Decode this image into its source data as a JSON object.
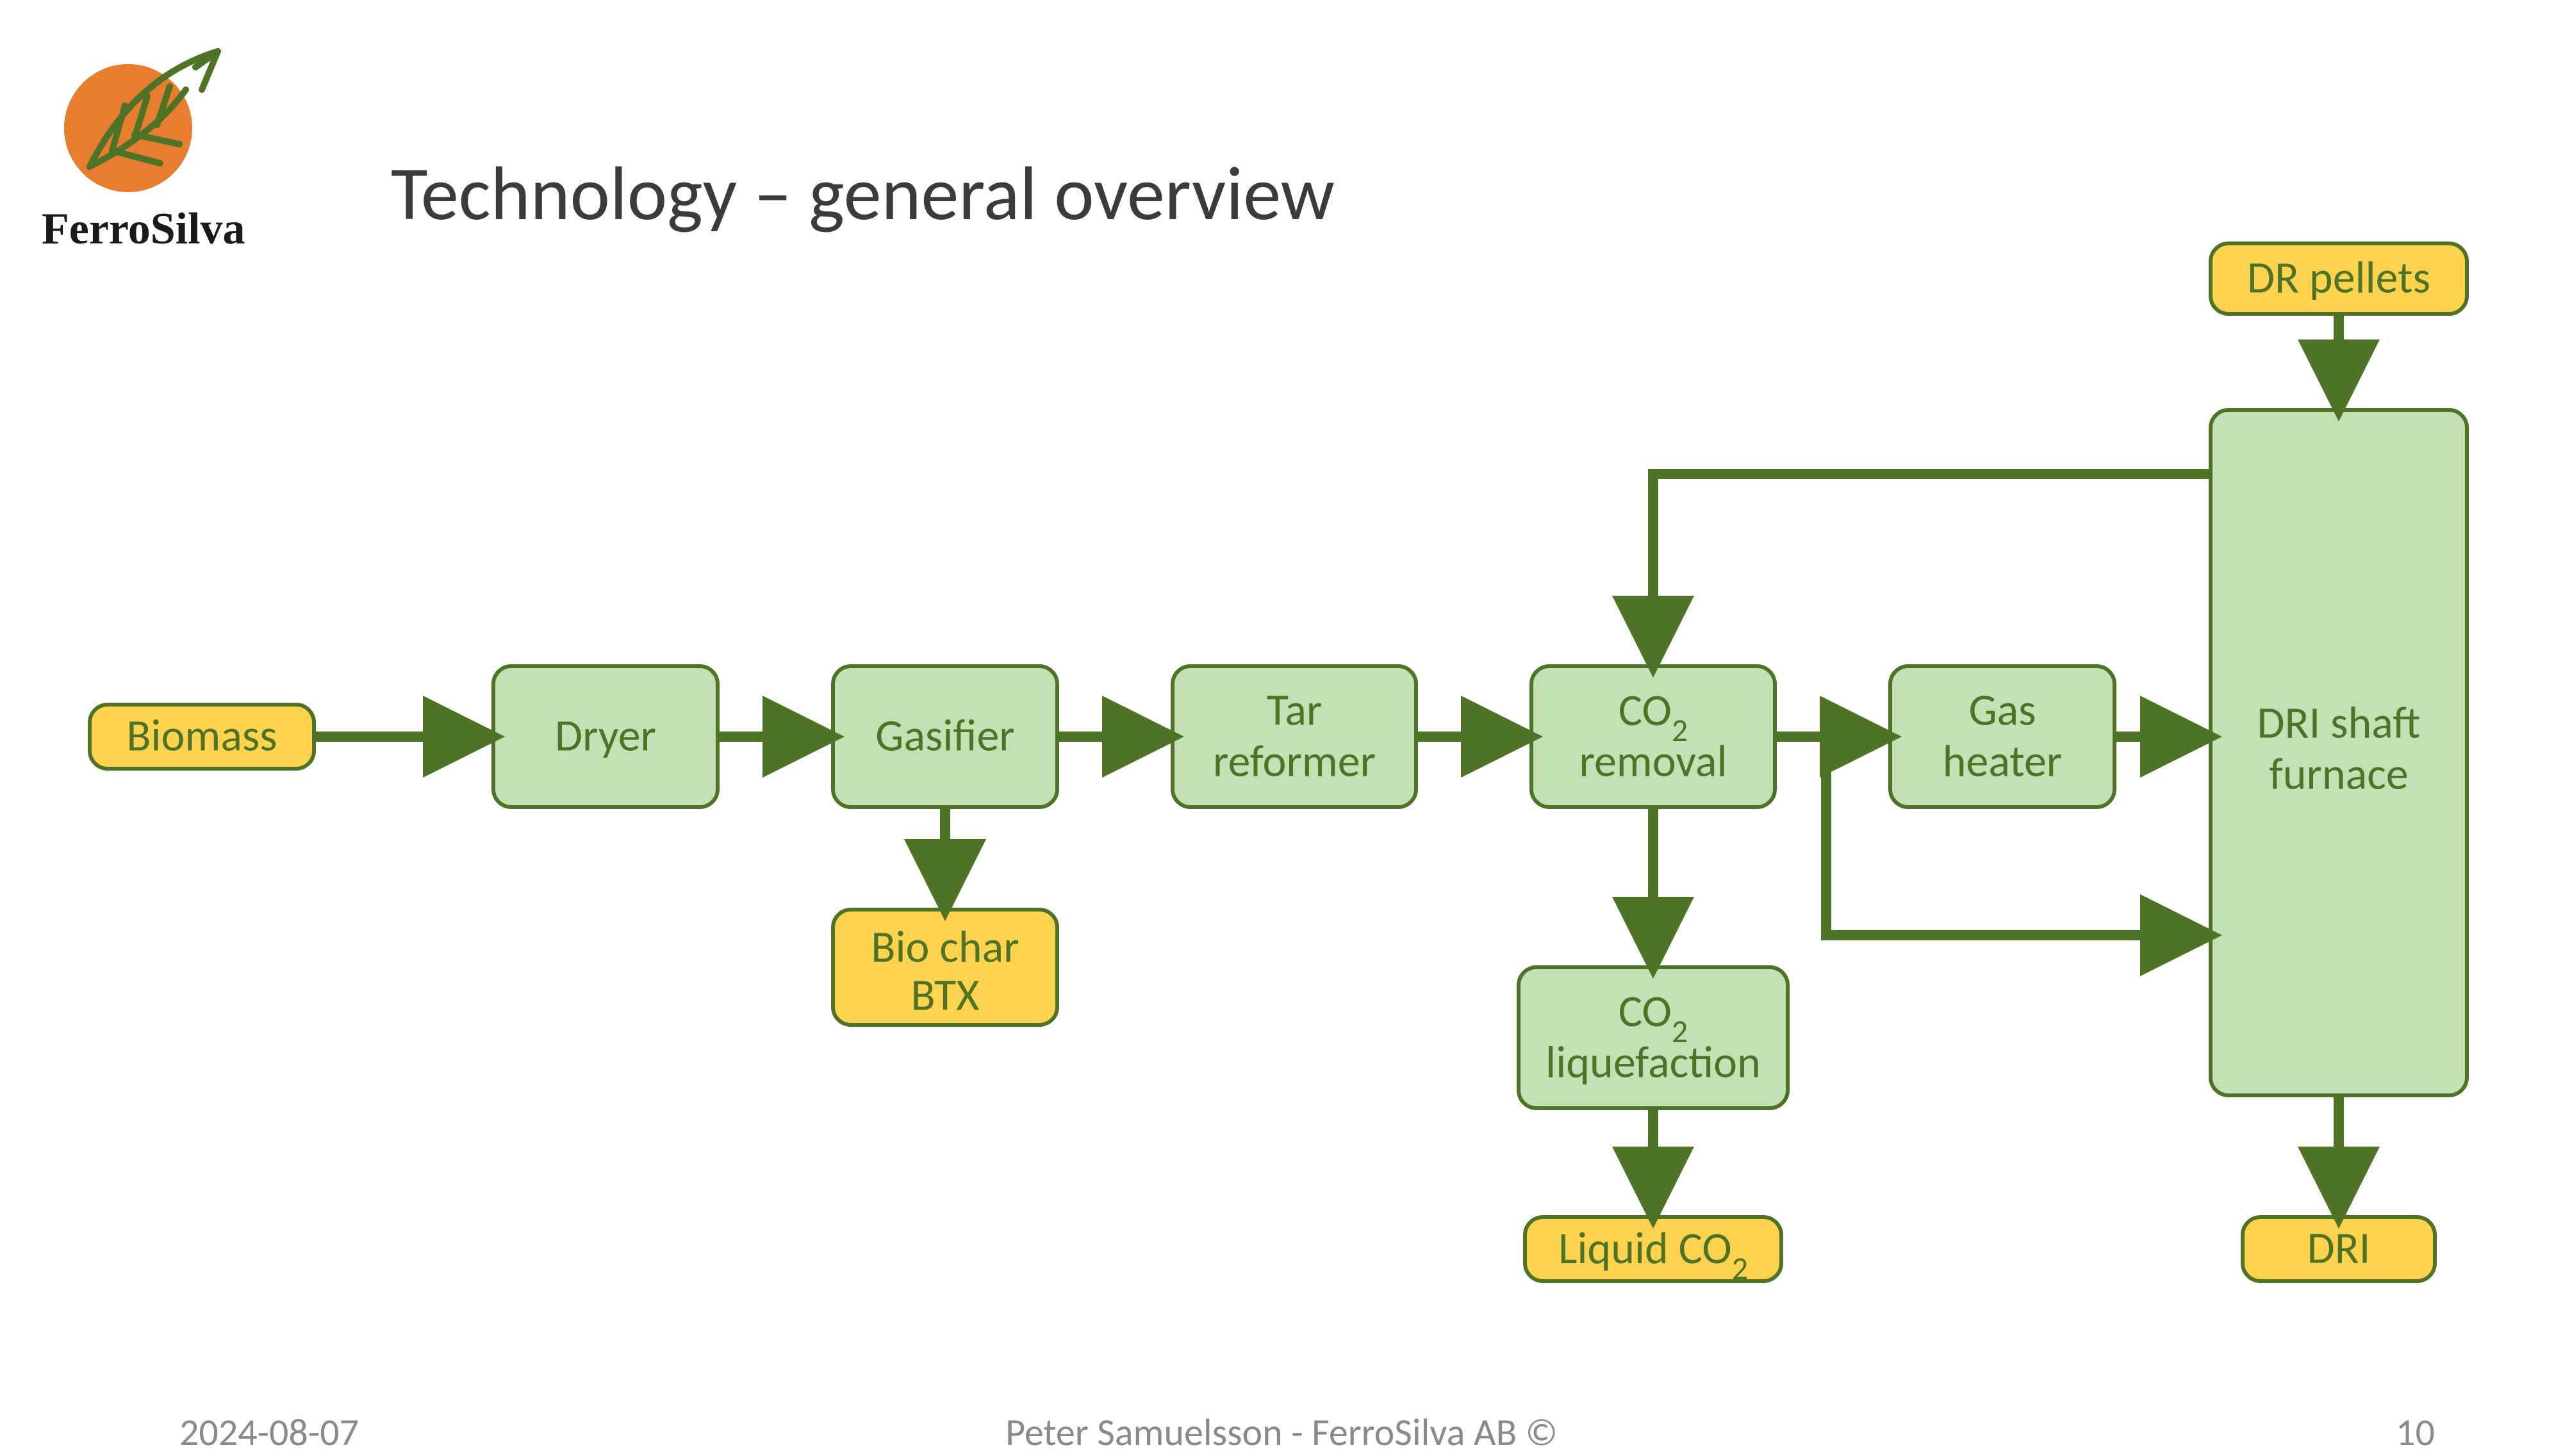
{
  "brand": "FerroSilva",
  "title": "Technology – general overview",
  "nodes": {
    "biomass": "Biomass",
    "dryer": "Dryer",
    "gasifier": "Gasifier",
    "biochar_l1": "Bio char",
    "biochar_l2": "BTX",
    "tar_l1": "Tar",
    "tar_l2": "reformer",
    "co2rem_l1": "CO",
    "co2rem_sub": "2",
    "co2rem_l2": "removal",
    "co2liq_l1": "CO",
    "co2liq_sub": "2",
    "co2liq_l2": "liquefaction",
    "liquidco2": "Liquid CO",
    "liquidco2_sub": "2",
    "gasheat_l1": "Gas",
    "gasheat_l2": "heater",
    "drpellets": "DR pellets",
    "drishaft_l1": "DRI shaft",
    "drishaft_l2": "furnace",
    "dri": "DRI"
  },
  "footer": {
    "date": "2024-08-07",
    "center": "Peter Samuelsson - FerroSilva AB ©",
    "page": "10"
  }
}
